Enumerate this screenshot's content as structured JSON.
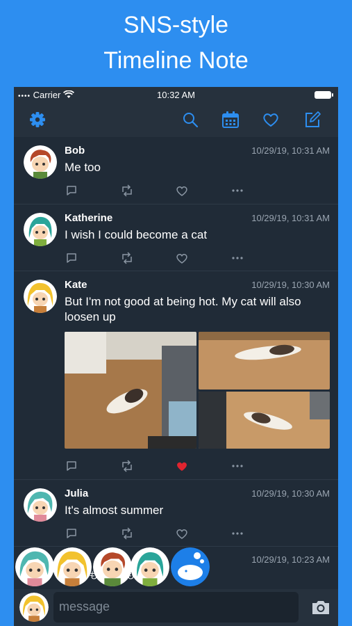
{
  "promo": {
    "line1": "SNS-style",
    "line2": "Timeline Note"
  },
  "status_bar": {
    "carrier": "Carrier",
    "time": "10:32 AM"
  },
  "toolbar": {
    "icons": [
      "gear-icon",
      "search-icon",
      "calendar-icon",
      "heart-icon",
      "compose-icon"
    ]
  },
  "posts": [
    {
      "name": "Bob",
      "time": "10/29/19, 10:31 AM",
      "text": "Me too",
      "liked": false
    },
    {
      "name": "Katherine",
      "time": "10/29/19, 10:31 AM",
      "text": "I wish I could become a cat",
      "liked": false
    },
    {
      "name": "Kate",
      "time": "10/29/19, 10:30 AM",
      "text": "But I'm not good at being hot. My cat will also loosen up",
      "liked": true,
      "photo_count": 3
    },
    {
      "name": "Julia",
      "time": "10/29/19, 10:30 AM",
      "text": "It's almost summer",
      "liked": false
    }
  ],
  "reactions": {
    "separator": "も",
    "time": "10/29/19, 10:23 AM"
  },
  "composer": {
    "placeholder": "message"
  },
  "colors": {
    "accent": "#2d8ef0",
    "like": "#e0242f",
    "background": "#202b37",
    "bar": "#26313d"
  }
}
